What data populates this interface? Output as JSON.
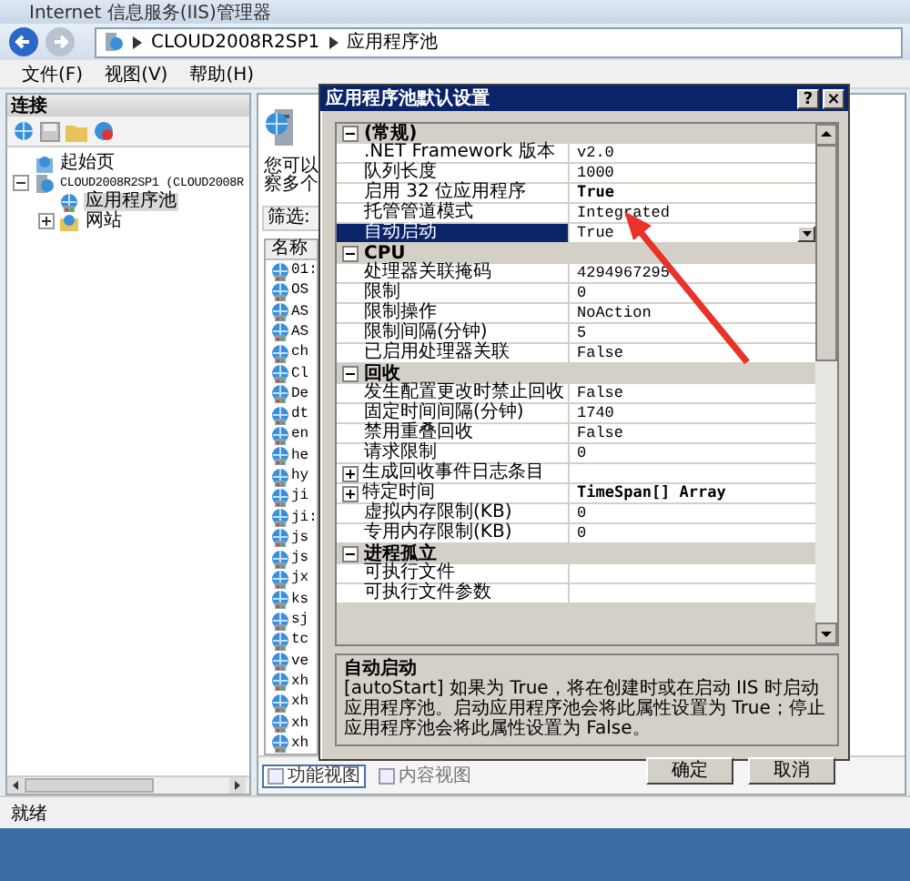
{
  "window": {
    "title": "Internet 信息服务(IIS)管理器"
  },
  "address_bar": {
    "segments": [
      "CLOUD2008R2SP1",
      "应用程序池"
    ]
  },
  "menu": [
    "文件(F)",
    "视图(V)",
    "帮助(H)"
  ],
  "connections": {
    "title": "连接",
    "tree": [
      {
        "label": "起始页",
        "kind": "start",
        "selected": false
      },
      {
        "label": "CLOUD2008R2SP1 (CLOUD2008R",
        "kind": "server",
        "expanded": true,
        "selected": false,
        "children": [
          {
            "label": "应用程序池",
            "kind": "pools",
            "selected": true
          },
          {
            "label": "网站",
            "kind": "sites",
            "expanded": false,
            "selected": false
          }
        ]
      }
    ]
  },
  "pools_pane": {
    "description_lines": [
      "您可以",
      "察多个"
    ],
    "filter_label": "筛选:",
    "column": "名称",
    "rows": [
      "01:",
      "OS",
      "AS",
      "AS",
      "ch",
      "Cl",
      "De",
      "dt",
      "en",
      "he",
      "hy",
      "ji",
      "ji:",
      "js",
      "js",
      "jx",
      "ks",
      "sj",
      "tc",
      "ve",
      "xh",
      "xh",
      "xh",
      "xh"
    ]
  },
  "view_tabs": [
    {
      "label": "功能视图",
      "selected": true
    },
    {
      "label": "内容视图",
      "selected": false
    }
  ],
  "status_bar": "就绪",
  "dialog": {
    "title": "应用程序池默认设置",
    "help_button": "?",
    "close_button": "×",
    "categories": [
      {
        "label": "(常规)",
        "expanded": true,
        "properties": [
          {
            "name": ".NET Framework 版本",
            "value": "v2.0",
            "modified": false,
            "selected": false
          },
          {
            "name": "队列长度",
            "value": "1000",
            "modified": false,
            "selected": false
          },
          {
            "name": "启用 32 位应用程序",
            "value": "True",
            "modified": true,
            "selected": false
          },
          {
            "name": "托管管道模式",
            "value": "Integrated",
            "modified": false,
            "selected": false
          },
          {
            "name": "自动启动",
            "value": "True",
            "modified": false,
            "selected": true
          }
        ]
      },
      {
        "label": "CPU",
        "expanded": true,
        "properties": [
          {
            "name": "处理器关联掩码",
            "value": "4294967295",
            "modified": false,
            "selected": false
          },
          {
            "name": "限制",
            "value": "0",
            "modified": false,
            "selected": false
          },
          {
            "name": "限制操作",
            "value": "NoAction",
            "modified": false,
            "selected": false
          },
          {
            "name": "限制间隔(分钟)",
            "value": "5",
            "modified": false,
            "selected": false
          },
          {
            "name": "已启用处理器关联",
            "value": "False",
            "modified": false,
            "selected": false
          }
        ]
      },
      {
        "label": "回收",
        "expanded": true,
        "properties": [
          {
            "name": "发生配置更改时禁止回收",
            "value": "False",
            "modified": false,
            "selected": false
          },
          {
            "name": "固定时间间隔(分钟)",
            "value": "1740",
            "modified": false,
            "selected": false
          },
          {
            "name": "禁用重叠回收",
            "value": "False",
            "modified": false,
            "selected": false
          },
          {
            "name": "请求限制",
            "value": "0",
            "modified": false,
            "selected": false
          },
          {
            "name": "生成回收事件日志条目",
            "kind": "group",
            "expanded": false,
            "selected": false
          },
          {
            "name": "特定时间",
            "kind": "group",
            "expanded": false,
            "value": "TimeSpan[] Array",
            "modified": true,
            "selected": false
          },
          {
            "name": "虚拟内存限制(KB)",
            "value": "0",
            "modified": false,
            "selected": false
          },
          {
            "name": "专用内存限制(KB)",
            "value": "0",
            "modified": false,
            "selected": false
          }
        ]
      },
      {
        "label": "进程孤立",
        "expanded": true,
        "properties": [
          {
            "name": "可执行文件",
            "selected": false
          },
          {
            "name": "可执行文件参数",
            "selected": false
          }
        ]
      }
    ],
    "description": {
      "title": "自动启动",
      "text": "[autoStart] 如果为 True，将在创建时或在启动 IIS 时启动应用程序池。启动应用程序池会将此属性设置为 True；停止应用程序池会将此属性设置为 False。"
    },
    "buttons": [
      "确定",
      "取消"
    ]
  }
}
